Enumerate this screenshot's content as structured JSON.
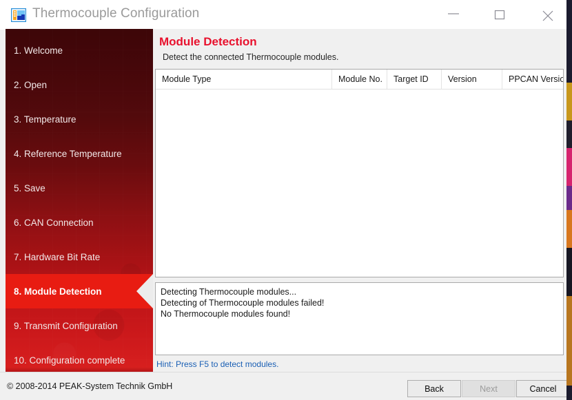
{
  "window": {
    "title": "Thermocouple Configuration",
    "icon": "application-window-icon",
    "controls": {
      "minimize": "minimize-icon",
      "maximize": "maximize-icon",
      "close": "close-icon"
    }
  },
  "sidebar": {
    "items": [
      {
        "label": "1. Welcome",
        "active": false
      },
      {
        "label": "2. Open",
        "active": false
      },
      {
        "label": "3. Temperature",
        "active": false
      },
      {
        "label": "4. Reference Temperature",
        "active": false
      },
      {
        "label": "5. Save",
        "active": false
      },
      {
        "label": "6. CAN Connection",
        "active": false
      },
      {
        "label": "7. Hardware Bit Rate",
        "active": false
      },
      {
        "label": "8. Module Detection",
        "active": true
      },
      {
        "label": "9. Transmit Configuration",
        "active": false
      },
      {
        "label": "10. Configuration complete",
        "active": false
      }
    ]
  },
  "page": {
    "title": "Module Detection",
    "subtitle": "Detect the connected Thermocouple modules.",
    "title_color": "#e8112d"
  },
  "table": {
    "columns": [
      {
        "label": "Module Type"
      },
      {
        "label": "Module No."
      },
      {
        "label": "Target ID"
      },
      {
        "label": "Version"
      },
      {
        "label": "PPCAN Version"
      }
    ],
    "rows": []
  },
  "log": {
    "lines": [
      "Detecting Thermocouple modules...",
      "Detecting of Thermocouple modules failed!",
      "No Thermocouple modules found!"
    ]
  },
  "hint": {
    "text": "Hint: Press F5 to detect modules.",
    "color": "#1a5fb4"
  },
  "footer": {
    "copyright": "© 2008-2014 PEAK-System Technik GmbH",
    "buttons": {
      "back": "Back",
      "next": "Next",
      "cancel": "Cancel"
    }
  }
}
